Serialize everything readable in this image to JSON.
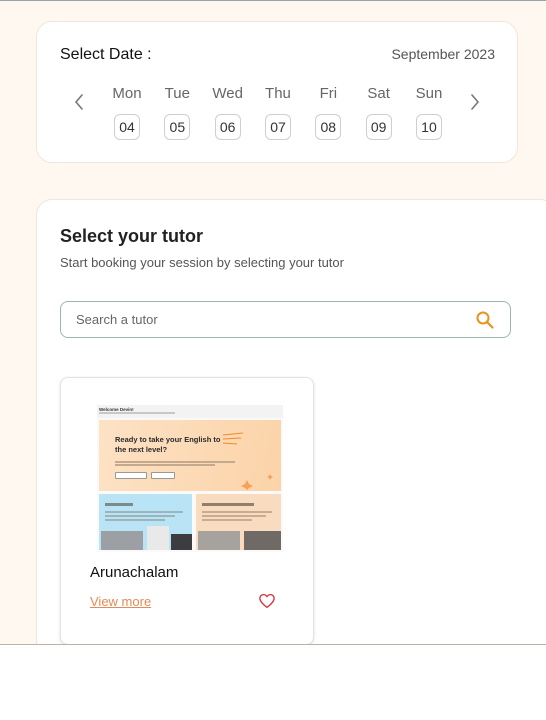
{
  "date_picker": {
    "title": "Select Date :",
    "month": "September 2023",
    "prev_icon": "chevron-left-icon",
    "next_icon": "chevron-right-icon",
    "days": [
      {
        "name": "Mon",
        "date": "04"
      },
      {
        "name": "Tue",
        "date": "05"
      },
      {
        "name": "Wed",
        "date": "06"
      },
      {
        "name": "Thu",
        "date": "07"
      },
      {
        "name": "Fri",
        "date": "08"
      },
      {
        "name": "Sat",
        "date": "09"
      },
      {
        "name": "Sun",
        "date": "10"
      }
    ]
  },
  "tutor_section": {
    "title": "Select your tutor",
    "subtitle": "Start booking your session by selecting your tutor",
    "search": {
      "placeholder": "Search a tutor",
      "value": "",
      "icon": "search-icon",
      "icon_color": "#e8931f"
    },
    "tutors": [
      {
        "name": "Arunachalam",
        "view_more_label": "View more",
        "favorite_icon": "heart-outline-icon",
        "thumbnail": {
          "welcome": "Welcome Devin!",
          "hero_title": "Ready to take your English to the next level?"
        }
      }
    ]
  },
  "colors": {
    "background": "#fff8f0",
    "card": "#ffffff",
    "accent_orange": "#e48b55",
    "search_icon": "#e8931f",
    "heart": "#d6323c",
    "search_border": "#9bb5b7"
  }
}
